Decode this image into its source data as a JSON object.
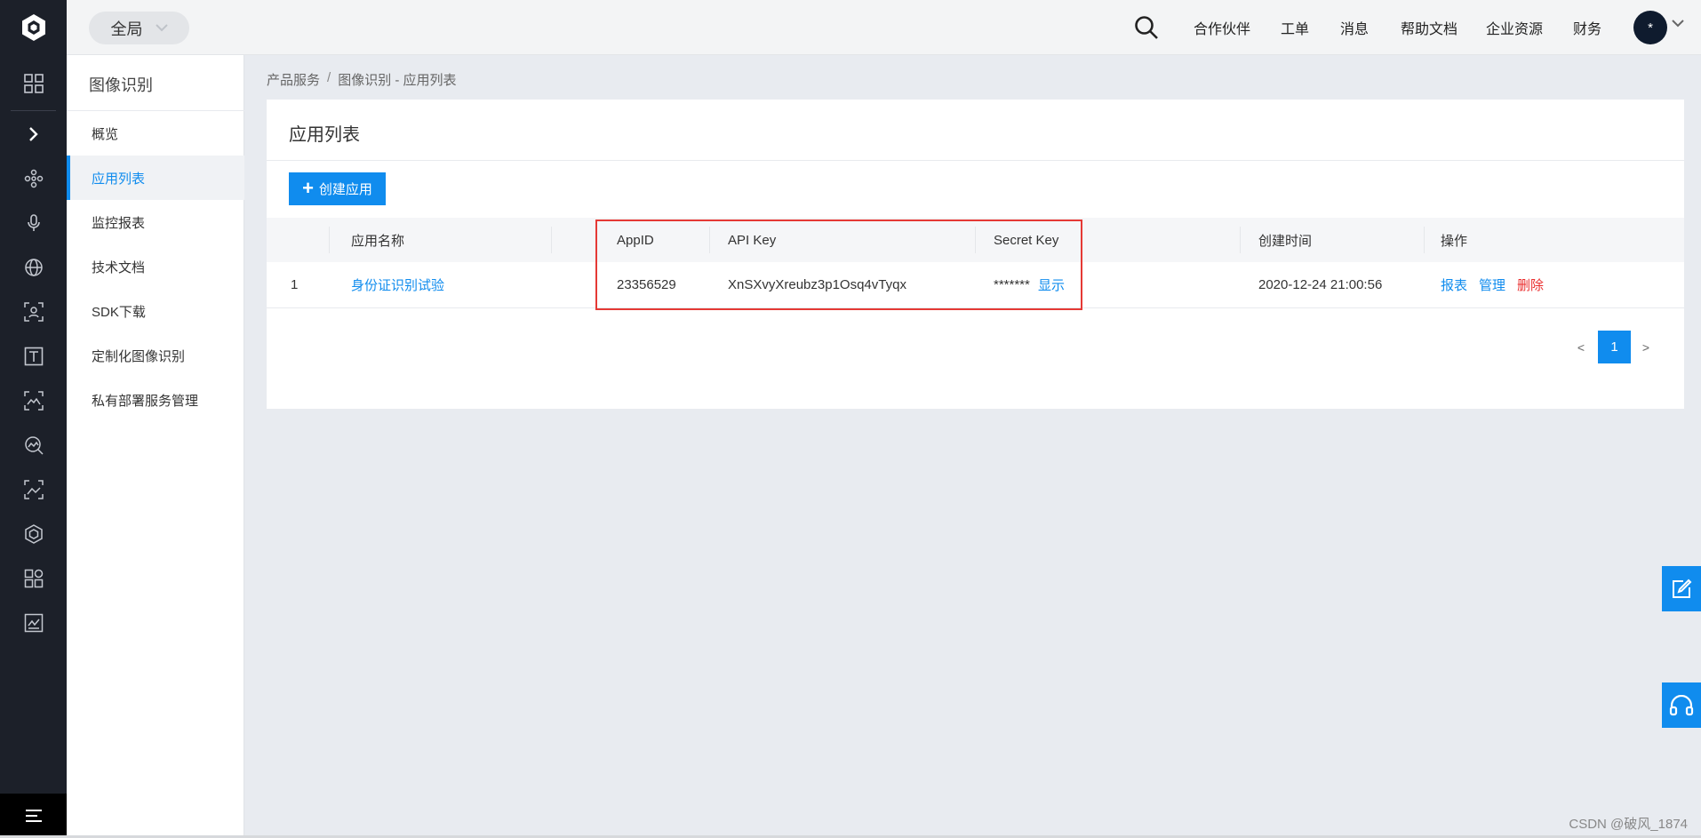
{
  "topbar": {
    "scope_label": "全局",
    "nav": [
      "合作伙伴",
      "工单",
      "消息",
      "帮助文档",
      "企业资源",
      "财务"
    ],
    "avatar_label": "*"
  },
  "sidebar": {
    "title": "图像识别",
    "items": [
      {
        "label": "概览",
        "active": false
      },
      {
        "label": "应用列表",
        "active": true
      },
      {
        "label": "监控报表",
        "active": false
      },
      {
        "label": "技术文档",
        "active": false
      },
      {
        "label": "SDK下载",
        "active": false
      },
      {
        "label": "定制化图像识别",
        "active": false
      },
      {
        "label": "私有部署服务管理",
        "active": false
      }
    ]
  },
  "breadcrumb": {
    "root": "产品服务",
    "separator": "/",
    "current": "图像识别 - 应用列表"
  },
  "card": {
    "title": "应用列表",
    "create_label": "创建应用"
  },
  "table": {
    "columns": [
      "应用名称",
      "AppID",
      "API Key",
      "Secret Key",
      "创建时间",
      "操作"
    ],
    "rows": [
      {
        "index": "1",
        "name": "身份证识别试验",
        "app_id": "23356529",
        "api_key": "XnSXvyXreubz3p1Osq4vTyqx",
        "secret_mask": "*******",
        "secret_toggle": "显示",
        "created": "2020-12-24 21:00:56",
        "actions": {
          "report": "报表",
          "manage": "管理",
          "delete": "删除"
        }
      }
    ]
  },
  "pagination": {
    "prev": "<",
    "current": "1",
    "next": ">"
  },
  "watermark": "CSDN @破风_1874",
  "colors": {
    "accent": "#108cee",
    "danger": "#ea2e2e",
    "rail": "#1c2029",
    "highlight_box": "#e53935"
  }
}
